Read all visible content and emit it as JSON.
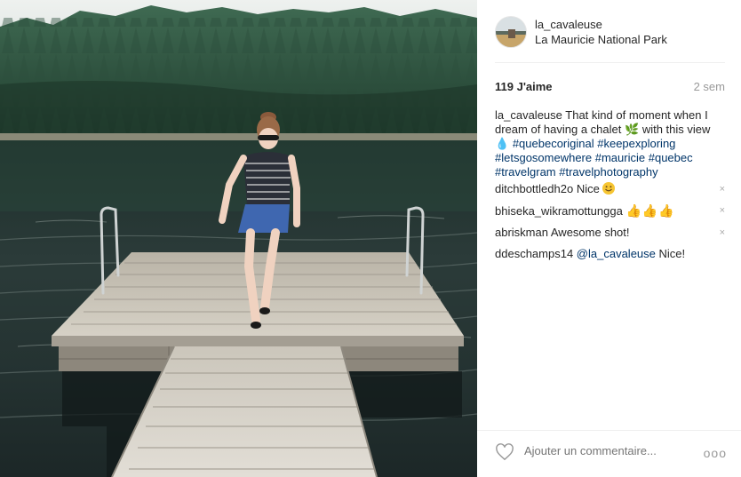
{
  "post": {
    "username": "la_cavaleuse",
    "location": "La Mauricie National Park",
    "likes": "119 J'aime",
    "age": "2 sem",
    "caption": {
      "username": "la_cavaleuse",
      "text": "That kind of moment when I dream of having a chalet",
      "text2": "with this view",
      "hashtags": [
        "#quebecoriginal",
        "#keepexploring",
        "#letsgosomewhere",
        "#mauricie",
        "#quebec",
        "#travelgram",
        "#travelphotography"
      ]
    },
    "comments": [
      {
        "username": "ditchbottledh2o",
        "text": "Nice",
        "emoji": "smile-icon"
      },
      {
        "username": "bhiseka_wikramottungga",
        "text": "",
        "emoji": "thumbs-up-icon"
      },
      {
        "username": "abriskman",
        "text": "Awesome shot!"
      },
      {
        "username": "ddeschamps14",
        "mention": "@la_cavaleuse",
        "text": "Nice!"
      }
    ],
    "delete_label": "×",
    "add_comment_placeholder": "Ajouter un commentaire...",
    "more_label": "ooo"
  }
}
